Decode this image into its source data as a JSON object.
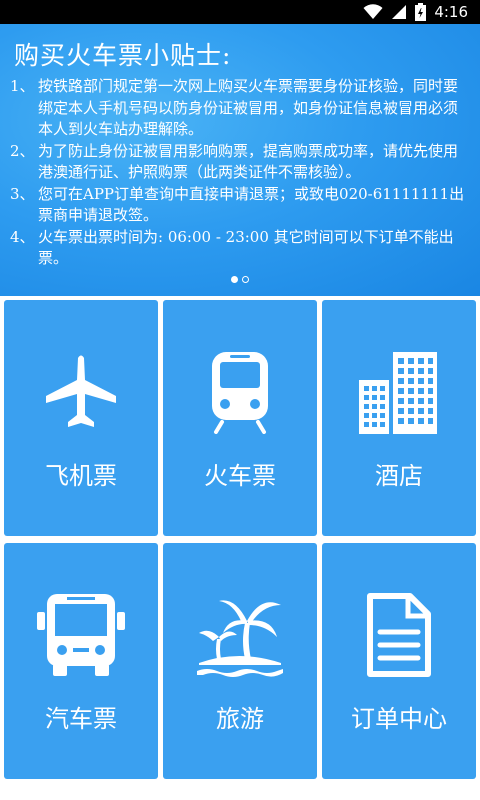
{
  "status_bar": {
    "time": "4:16"
  },
  "banner": {
    "title": "购买火车票小贴士:",
    "tips": [
      {
        "num": "1、",
        "text": "按铁路部门规定第一次网上购买火车票需要身份证核验，同时要绑定本人手机号码以防身份证被冒用，如身份证信息被冒用必须本人到火车站办理解除。"
      },
      {
        "num": "2、",
        "text": "为了防止身份证被冒用影响购票，提高购票成功率，请优先使用港澳通行证、护照购票（此两类证件不需核验）。"
      },
      {
        "num": "3、",
        "text": "您可在APP订单查询中直接申请退票；或致电020-61111111出票商申请退改签。"
      },
      {
        "num": "4、",
        "text": "火车票出票时间为: 06:00 - 23:00 其它时间可以下订单不能出票。"
      }
    ],
    "page_count": 2,
    "active_page": 1
  },
  "menu": {
    "items": [
      {
        "id": "flight",
        "label": "飞机票",
        "icon": "airplane-icon"
      },
      {
        "id": "train",
        "label": "火车票",
        "icon": "train-icon"
      },
      {
        "id": "hotel",
        "label": "酒店",
        "icon": "building-icon"
      },
      {
        "id": "bus",
        "label": "汽车票",
        "icon": "bus-icon"
      },
      {
        "id": "travel",
        "label": "旅游",
        "icon": "palm-tree-icon"
      },
      {
        "id": "orders",
        "label": "订单中心",
        "icon": "document-icon"
      }
    ]
  },
  "colors": {
    "tile": "#3aa0f0",
    "banner": "#2e9cf0",
    "status_bar": "#000000"
  }
}
